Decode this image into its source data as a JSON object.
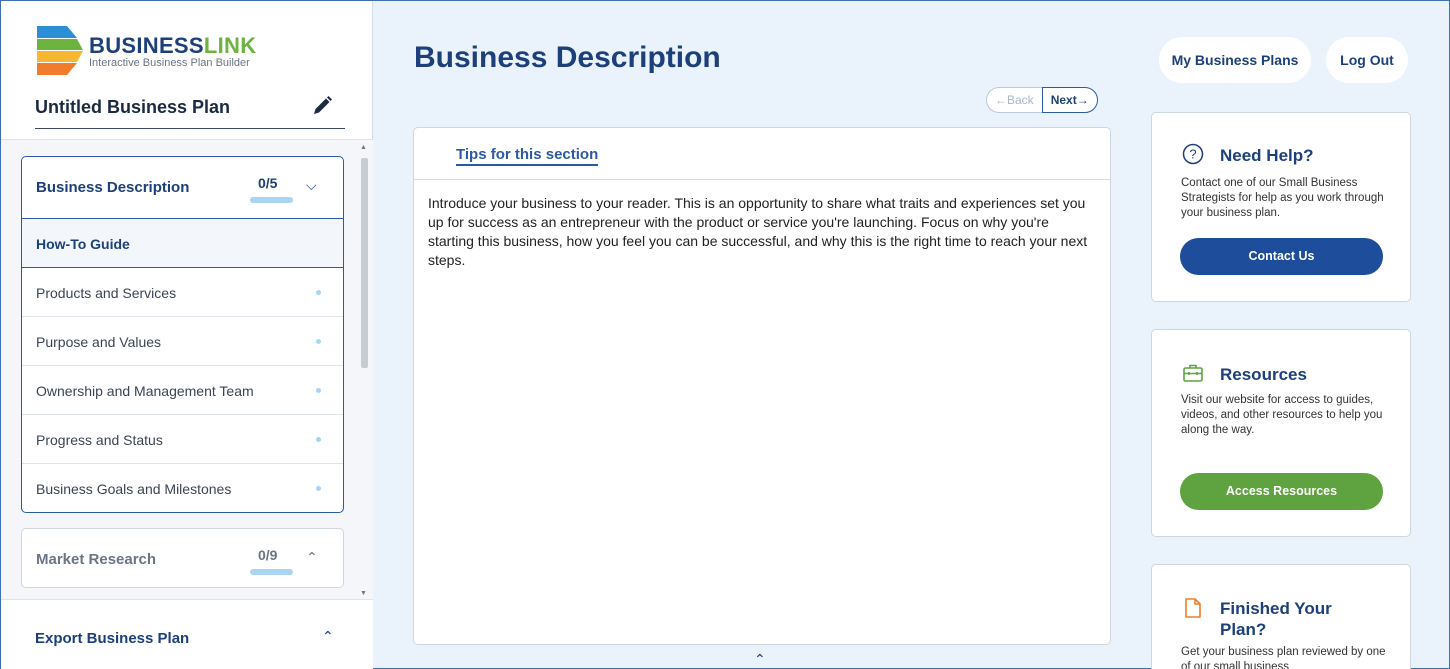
{
  "app": {
    "brand_main": "BUSINESS",
    "brand_accent": "LINK",
    "brand_subtitle": "Interactive Business Plan Builder",
    "plan_name": "Untitled Business Plan"
  },
  "sidebar": {
    "active_section": {
      "title": "Business Description",
      "count": "0/5",
      "progress": 0,
      "items": [
        {
          "label": "How-To Guide",
          "active": true
        },
        {
          "label": "Products and Services"
        },
        {
          "label": "Purpose and Values"
        },
        {
          "label": "Ownership and Management Team"
        },
        {
          "label": "Progress and Status"
        },
        {
          "label": "Business Goals and Milestones"
        }
      ]
    },
    "collapsed_section": {
      "title": "Market Research",
      "count": "0/9",
      "progress": 0
    },
    "export_label": "Export Business Plan"
  },
  "main": {
    "page_title": "Business Description",
    "back_label": "←Back",
    "next_label": "Next→",
    "tips_link": "Tips for this section",
    "tips_text": "Introduce your business to your reader. This is an opportunity to share what traits and experiences set you up for success as an entrepreneur with the product or service you're launching. Focus on why you're starting this business, how you feel you can be successful, and why this is the right time to reach your next steps."
  },
  "header": {
    "my_plans_label": "My Business Plans",
    "logout_label": "Log Out"
  },
  "right": {
    "help": {
      "title": "Need Help?",
      "text": "Contact one of our Small Business Strategists for help as you work through your business plan.",
      "button": "Contact Us",
      "icon": "question-circle-icon"
    },
    "resources": {
      "title": "Resources",
      "text": "Visit our website for access to guides, videos, and other resources to help you along the way.",
      "button": "Access Resources",
      "icon": "briefcase-icon"
    },
    "finished": {
      "title": "Finished Your Plan?",
      "text": "Get your business plan reviewed by one of our small business",
      "icon": "document-icon"
    }
  },
  "colors": {
    "primary": "#1d3f7a",
    "button_blue": "#1e4d9b",
    "button_green": "#5ea340",
    "accent_orange": "#f07d2b",
    "background": "#eaf2fb"
  }
}
